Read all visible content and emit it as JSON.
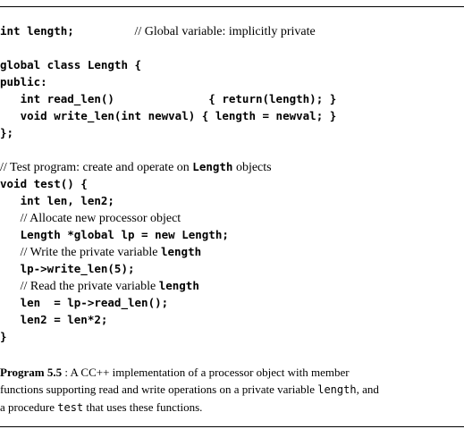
{
  "code_lines": [
    {
      "parts": [
        {
          "t": "int length;         ",
          "k": "mono"
        },
        {
          "t": "// Global variable: implicitly private",
          "k": "serif"
        }
      ]
    },
    {
      "parts": []
    },
    {
      "parts": [
        {
          "t": "global class Length {",
          "k": "mono"
        }
      ]
    },
    {
      "parts": [
        {
          "t": "public:",
          "k": "mono"
        }
      ]
    },
    {
      "parts": [
        {
          "t": "   int read_len()              { return(length); }",
          "k": "mono"
        }
      ]
    },
    {
      "parts": [
        {
          "t": "   void write_len(int newval) { length = newval; }",
          "k": "mono"
        }
      ]
    },
    {
      "parts": [
        {
          "t": "};",
          "k": "mono"
        }
      ]
    },
    {
      "parts": []
    },
    {
      "parts": [
        {
          "t": "// Test program: create and operate on ",
          "k": "serif"
        },
        {
          "t": "Length",
          "k": "mono"
        },
        {
          "t": " objects",
          "k": "serif"
        }
      ]
    },
    {
      "parts": [
        {
          "t": "void test() {",
          "k": "mono"
        }
      ]
    },
    {
      "parts": [
        {
          "t": "   int len, len2;",
          "k": "mono"
        }
      ]
    },
    {
      "parts": [
        {
          "t": "   ",
          "k": "mono"
        },
        {
          "t": "// Allocate new processor object",
          "k": "serif"
        }
      ]
    },
    {
      "parts": [
        {
          "t": "   Length *global lp = new Length;",
          "k": "mono"
        }
      ]
    },
    {
      "parts": [
        {
          "t": "   ",
          "k": "mono"
        },
        {
          "t": "// Write the private variable ",
          "k": "serif"
        },
        {
          "t": "length",
          "k": "mono"
        }
      ]
    },
    {
      "parts": [
        {
          "t": "   lp->write_len(5);",
          "k": "mono"
        }
      ]
    },
    {
      "parts": [
        {
          "t": "   ",
          "k": "mono"
        },
        {
          "t": "// Read the private variable ",
          "k": "serif"
        },
        {
          "t": "length",
          "k": "mono"
        }
      ]
    },
    {
      "parts": [
        {
          "t": "   len  = lp->read_len();",
          "k": "mono"
        }
      ]
    },
    {
      "parts": [
        {
          "t": "   len2 = len*2;",
          "k": "mono"
        }
      ]
    },
    {
      "parts": [
        {
          "t": "}",
          "k": "mono"
        }
      ]
    }
  ],
  "caption": {
    "label": "Program 5.5",
    "line1": " : A CC++  implementation of a processor object with member",
    "line2_pre": "functions supporting read and write operations on a private variable ",
    "line2_code": "length",
    "line2_post": ", and",
    "line3_pre": "a procedure ",
    "line3_code": "test",
    "line3_post": " that uses these functions."
  }
}
